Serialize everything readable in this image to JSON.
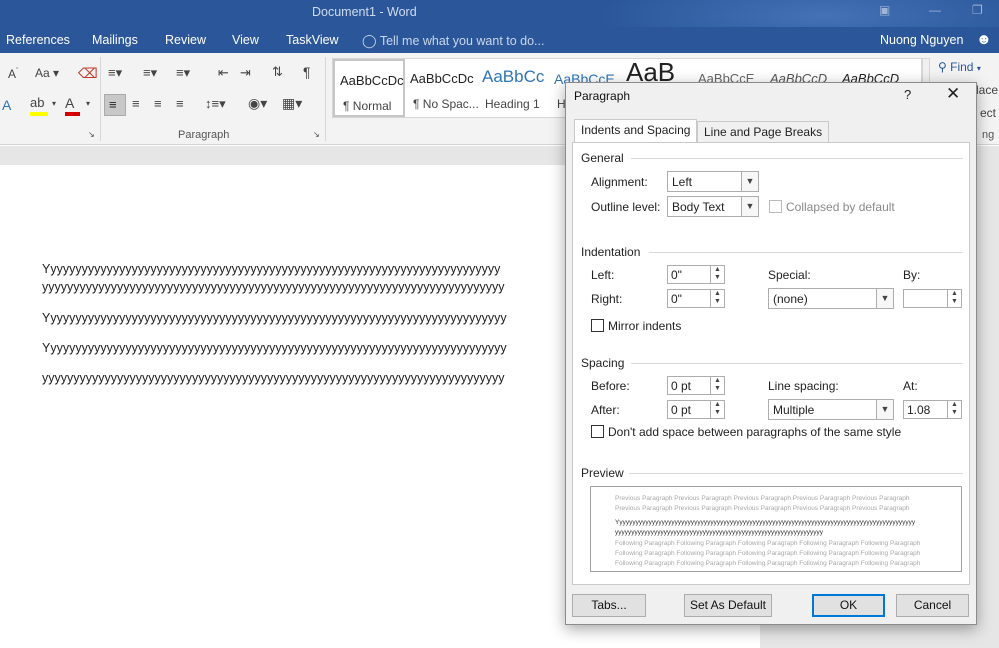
{
  "window": {
    "title": "Document1 - Word"
  },
  "tabs": [
    "References",
    "Mailings",
    "Review",
    "View",
    "TaskView"
  ],
  "tell_me": "Tell me what you want to do...",
  "user_name": "Nuong Nguyen",
  "ribbon": {
    "paragraph_group_label": "Paragraph",
    "find_label": "Find",
    "replace_partial": "lace",
    "select_partial": "ect",
    "editing_partial": "ng",
    "styles": [
      {
        "sample": "AaBbCcDc",
        "name": "¶ Normal"
      },
      {
        "sample": "AaBbCcDc",
        "name": "¶ No Spac..."
      },
      {
        "sample": "AaBbCc",
        "name": "Heading 1"
      },
      {
        "sample": "AaBbCcE",
        "name": "H"
      },
      {
        "sample": "AaB",
        "name": ""
      },
      {
        "sample": "AaBbCcE",
        "name": ""
      },
      {
        "sample": "AaBbCcD",
        "name": ""
      },
      {
        "sample": "AaBbCcD",
        "name": ""
      }
    ],
    "colors": {
      "accent": "#2b579a",
      "highlight": "#ffff00",
      "font_color": "#d40000"
    }
  },
  "document": {
    "lines": [
      "Yyyyyyyyyyyyyyyyyyyyyyyyyyyyyyyyyyyyyyyyyyyyyyyyyyyyyyyyyyyyyyyyyyyyyyyyy",
      "yyyyyyyyyyyyyyyyyyyyyyyyyyyyyyyyyyyyyyyyyyyyyyyyyyyyyyyyyyyyyyyyyyyyyyyyyy",
      "Yyyyyyyyyyyyyyyyyyyyyyyyyyyyyyyyyyyyyyyyyyyyyyyyyyyyyyyyyyyyyyyyyyyyyyyyyy",
      "Yyyyyyyyyyyyyyyyyyyyyyyyyyyyyyyyyyyyyyyyyyyyyyyyyyyyyyyyyyyyyyyyyyyyyyyyyy",
      "yyyyyyyyyyyyyyyyyyyyyyyyyyyyyyyyyyyyyyyyyyyyyyyyyyyyyyyyyyyyyyyyyyyyyyyyyy"
    ]
  },
  "dialog": {
    "title": "Paragraph",
    "help": "?",
    "close": "✕",
    "tabs": [
      "Indents and Spacing",
      "Line and Page Breaks"
    ],
    "general": {
      "heading": "General",
      "alignment_label": "Alignment:",
      "alignment_value": "Left",
      "outline_label": "Outline level:",
      "outline_value": "Body Text",
      "collapsed_label": "Collapsed by default"
    },
    "indentation": {
      "heading": "Indentation",
      "left_label": "Left:",
      "left_value": "0\"",
      "right_label": "Right:",
      "right_value": "0\"",
      "special_label": "Special:",
      "special_value": "(none)",
      "by_label": "By:",
      "by_value": "",
      "mirror_label": "Mirror indents"
    },
    "spacing": {
      "heading": "Spacing",
      "before_label": "Before:",
      "before_value": "0 pt",
      "after_label": "After:",
      "after_value": "0 pt",
      "line_spacing_label": "Line spacing:",
      "line_spacing_value": "Multiple",
      "at_label": "At:",
      "at_value": "1.08",
      "dont_add_label": "Don't add space between paragraphs of the same style"
    },
    "preview": {
      "heading": "Preview",
      "previous": "Previous Paragraph Previous Paragraph Previous Paragraph Previous Paragraph Previous Paragraph",
      "previous2": "Previous Paragraph Previous Paragraph Previous Paragraph Previous Paragraph Previous Paragraph",
      "main1": "Yyyyyyyyyyyyyyyyyyyyyyyyyyyyyyyyyyyyyyyyyyyyyyyyyyyyyyyyyyyyyyyyyyyyyyyyyyyyyyyyyyyyyyyyyyyy",
      "main2": "yyyyyyyyyyyyyyyyyyyyyyyyyyyyyyyyyyyyyyyyyyyyyyyyyyyyyyyyyyyyyyyy",
      "following": "Following Paragraph Following Paragraph Following Paragraph Following Paragraph Following Paragraph"
    },
    "buttons": {
      "tabs": "Tabs...",
      "set_default": "Set As Default",
      "ok": "OK",
      "cancel": "Cancel"
    }
  }
}
